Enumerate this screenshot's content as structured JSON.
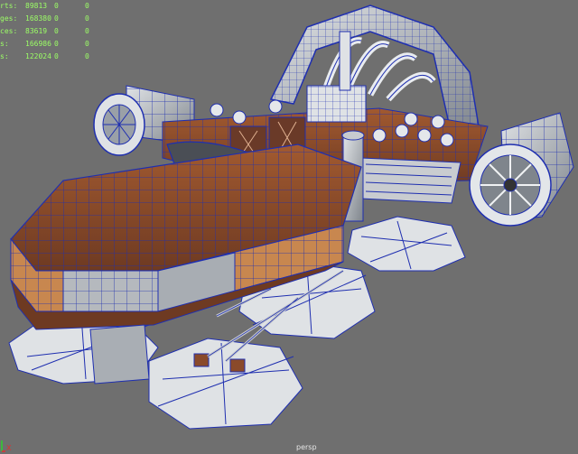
{
  "viewport": {
    "camera_name": "persp",
    "background": "#6f6f6f",
    "wire_color": "#1f2fb0",
    "hud_color": "#9cff66"
  },
  "hud": {
    "rows": [
      {
        "label": "rts:",
        "v1": "89813",
        "v2": "0",
        "v3": "0"
      },
      {
        "label": "ges:",
        "v1": "168380",
        "v2": "0",
        "v3": "0"
      },
      {
        "label": "ces:",
        "v1": "83619",
        "v2": "0",
        "v3": "0"
      },
      {
        "label": "s:",
        "v1": "166986",
        "v2": "0",
        "v3": "0"
      },
      {
        "label": "s:",
        "v1": "122024",
        "v2": "0",
        "v3": "0"
      }
    ]
  },
  "axis": {
    "x_label": "X"
  },
  "model": {
    "hull_color": "#8a4a2a",
    "metal_color": "#b9bdc2",
    "trim_color": "#d48a4e"
  }
}
